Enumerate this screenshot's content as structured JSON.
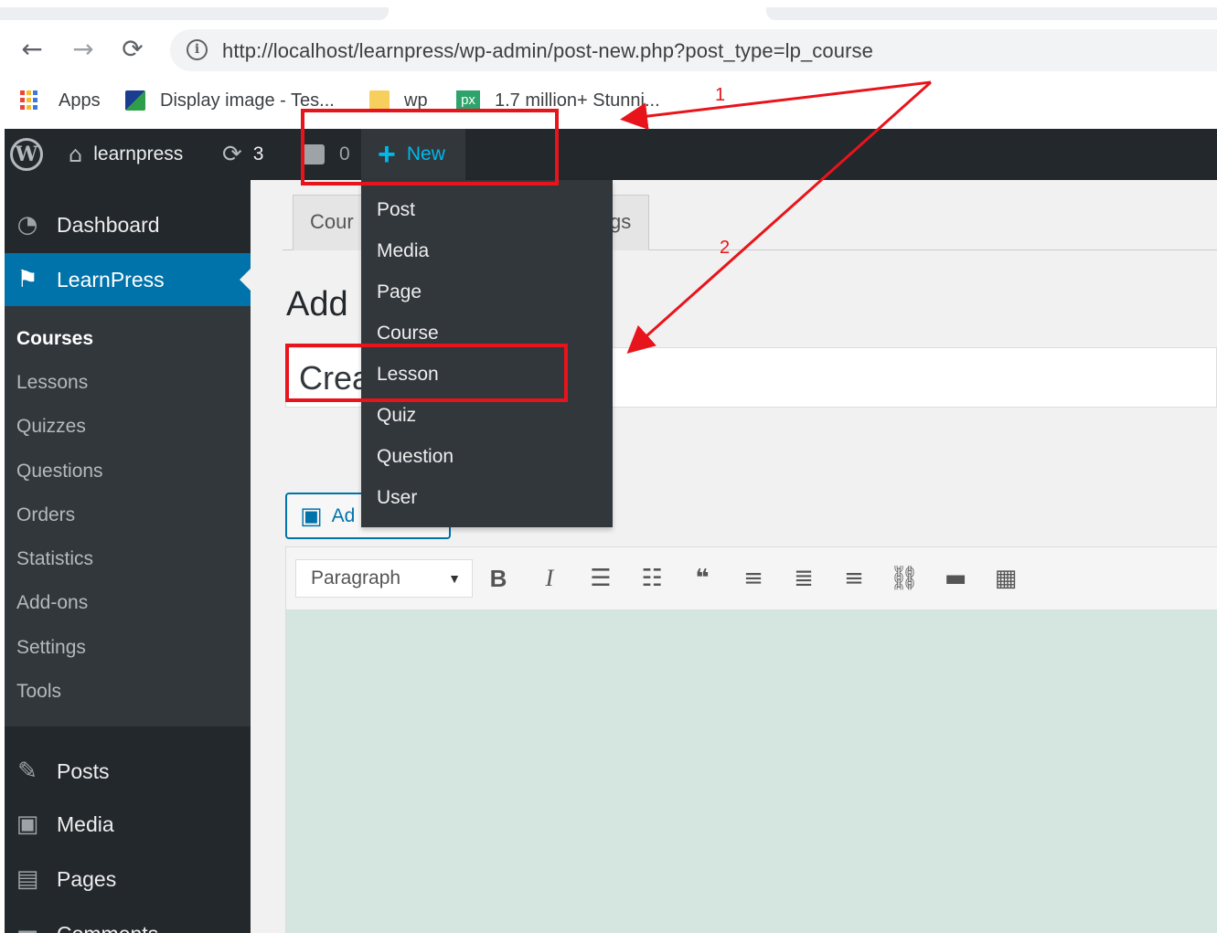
{
  "browser": {
    "nav": {
      "back": "←",
      "forward": "→",
      "reload": "⟳"
    },
    "url": "http://localhost/learnpress/wp-admin/post-new.php?post_type=lp_course",
    "bookmarks": [
      {
        "label": "Apps",
        "icon": "apps-grid-icon"
      },
      {
        "label": "Display image - Tes...",
        "icon": "site-favicon"
      },
      {
        "label": "wp",
        "icon": "folder-icon"
      },
      {
        "label": "1.7 million+ Stunni...",
        "icon": "pexels-icon",
        "icon_text": "px"
      }
    ]
  },
  "adminbar": {
    "site": "learnpress",
    "updates": "3",
    "comments": "0",
    "new_label": "New",
    "new_menu": [
      "Post",
      "Media",
      "Page",
      "Course",
      "Lesson",
      "Quiz",
      "Question",
      "User"
    ]
  },
  "sidebar": {
    "dashboard": "Dashboard",
    "learnpress": "LearnPress",
    "submenu": [
      "Courses",
      "Lessons",
      "Quizzes",
      "Questions",
      "Orders",
      "Statistics",
      "Add-ons",
      "Settings",
      "Tools"
    ],
    "posts": "Posts",
    "media": "Media",
    "pages": "Pages",
    "comments": "Comments"
  },
  "content": {
    "tab_course": "Cour",
    "tab_settings": "gs",
    "heading": "Add",
    "title_value": "Crea",
    "add_media": "Ad",
    "format_select": "Paragraph",
    "toolbar_icons": [
      "bold-icon",
      "italic-icon",
      "bullet-list-icon",
      "numbered-list-icon",
      "blockquote-icon",
      "align-left-icon",
      "align-center-icon",
      "align-right-icon",
      "link-icon",
      "read-more-icon",
      "toolbar-toggle-icon"
    ]
  },
  "annotations": {
    "label_1": "1",
    "label_2": "2",
    "color": "#e8141b"
  },
  "colors": {
    "adminbar": "#23282d",
    "active_menu": "#0073aa",
    "new_accent": "#00b9eb",
    "editor_bg": "#d5e5df"
  }
}
